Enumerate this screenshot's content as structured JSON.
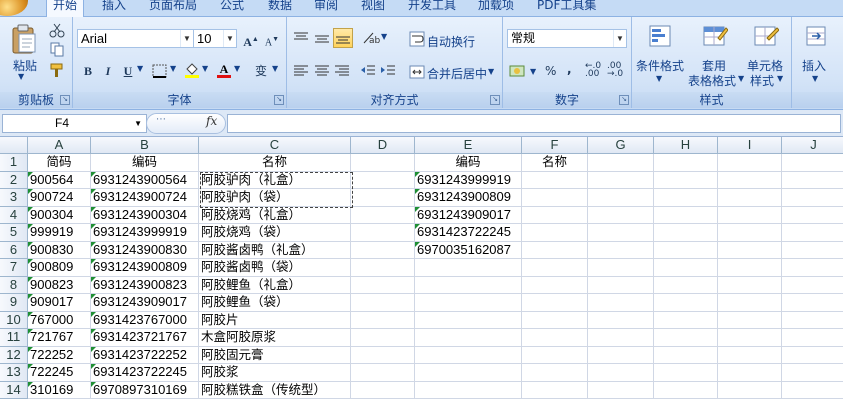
{
  "tabs": [
    "开始",
    "插入",
    "页面布局",
    "公式",
    "数据",
    "审阅",
    "视图",
    "开发工具",
    "加载项",
    "PDF工具集"
  ],
  "ribbon": {
    "clipboard": {
      "paste_label": "粘贴",
      "group_label": "剪贴板"
    },
    "font": {
      "font_name": "Arial",
      "font_size": "10",
      "bold": "B",
      "italic": "I",
      "underline": "U",
      "grow": "A",
      "shrink": "A",
      "color_a": "A",
      "phonetic": "变",
      "group_label": "字体"
    },
    "alignment": {
      "wrap_text": "自动换行",
      "merge_center": "合并后居中",
      "group_label": "对齐方式"
    },
    "number": {
      "format": "常规",
      "percent": "%",
      "comma": ",",
      "group_label": "数字"
    },
    "styles": {
      "conditional_1": "条件格式",
      "table_1": "套用",
      "table_2": "表格格式",
      "cell_1": "单元格",
      "cell_2": "样式",
      "group_label": "样式"
    },
    "cells": {
      "insert": "插入"
    },
    "colors": {
      "accent": "#15428b",
      "tab_bg": "#c5dbf5",
      "ribbon_bg": "#d3e3f7",
      "highlight": "#ffd35c"
    }
  },
  "formula_bar": {
    "name_box": "F4",
    "fx": "fx",
    "value": ""
  },
  "columns": [
    "A",
    "B",
    "C",
    "D",
    "E",
    "F",
    "G",
    "H",
    "I",
    "J"
  ],
  "rows": [
    {
      "n": "1",
      "a": "简码",
      "b": "编码",
      "c": "名称",
      "e": "编码",
      "f": "名称"
    },
    {
      "n": "2",
      "a": "900564",
      "b": "6931243900564",
      "c": "阿胶驴肉（礼盒）",
      "e": "6931243999919"
    },
    {
      "n": "3",
      "a": "900724",
      "b": "6931243900724",
      "c": "阿胶驴肉（袋）",
      "e": "6931243900809"
    },
    {
      "n": "4",
      "a": "900304",
      "b": "6931243900304",
      "c": "阿胶烧鸡（礼盒）",
      "e": "6931243909017"
    },
    {
      "n": "5",
      "a": "999919",
      "b": "6931243999919",
      "c": "阿胶烧鸡（袋）",
      "e": "6931423722245"
    },
    {
      "n": "6",
      "a": "900830",
      "b": "6931243900830",
      "c": "阿胶酱卤鸭（礼盒）",
      "e": "6970035162087"
    },
    {
      "n": "7",
      "a": "900809",
      "b": "6931243900809",
      "c": "阿胶酱卤鸭（袋）",
      "e": ""
    },
    {
      "n": "8",
      "a": "900823",
      "b": "6931243900823",
      "c": "阿胶鲤鱼（礼盒）",
      "e": ""
    },
    {
      "n": "9",
      "a": "909017",
      "b": "6931243909017",
      "c": "阿胶鲤鱼（袋）",
      "e": ""
    },
    {
      "n": "10",
      "a": "767000",
      "b": "6931423767000",
      "c": "阿胶片",
      "e": ""
    },
    {
      "n": "11",
      "a": "721767",
      "b": "6931423721767",
      "c": "木盒阿胶原浆",
      "e": ""
    },
    {
      "n": "12",
      "a": "722252",
      "b": "6931423722252",
      "c": "阿胶固元膏",
      "e": ""
    },
    {
      "n": "13",
      "a": "722245",
      "b": "6931423722245",
      "c": "阿胶浆",
      "e": ""
    },
    {
      "n": "14",
      "a": "310169",
      "b": "6970897310169",
      "c": "阿胶糕铁盒（传统型）",
      "e": ""
    }
  ]
}
